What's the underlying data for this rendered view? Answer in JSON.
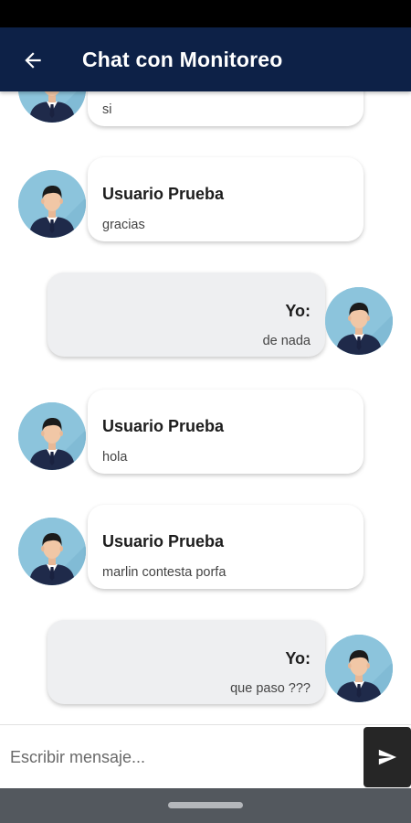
{
  "app_bar": {
    "title": "Chat con Monitoreo",
    "back_icon": "arrow-left-icon"
  },
  "messages": [
    {
      "direction": "in",
      "sender": "",
      "text": "si"
    },
    {
      "direction": "in",
      "sender": "Usuario Prueba",
      "text": "gracias"
    },
    {
      "direction": "out",
      "sender": "Yo:",
      "text": "de nada"
    },
    {
      "direction": "in",
      "sender": "Usuario Prueba",
      "text": "hola"
    },
    {
      "direction": "in",
      "sender": "Usuario Prueba",
      "text": "marlin contesta porfa"
    },
    {
      "direction": "out",
      "sender": "Yo:",
      "text": "que paso ???"
    }
  ],
  "composer": {
    "placeholder": "Escribir mensaje...",
    "value": "",
    "send_icon": "send-icon"
  },
  "colors": {
    "app_bar": "#0d2147",
    "incoming_bubble": "#ffffff",
    "outgoing_bubble": "#eeeff1",
    "avatar_bg": "#8cc4dc",
    "send_button": "#262626",
    "nav_bar": "#53585e"
  }
}
